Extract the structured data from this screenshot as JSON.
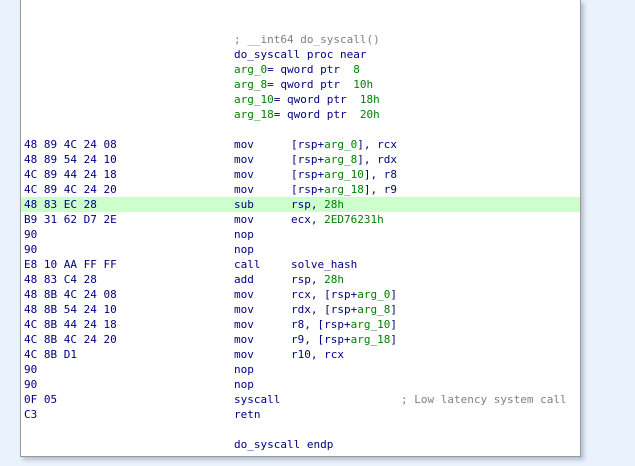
{
  "header_comment": "; __int64 do_syscall()",
  "proc_start": "do_syscall proc near",
  "args": [
    {
      "name": "arg_0",
      "rest": "= qword ptr  ",
      "val": "8"
    },
    {
      "name": "arg_8",
      "rest": "= qword ptr  ",
      "val": "10h"
    },
    {
      "name": "arg_10",
      "rest": "= qword ptr  ",
      "val": "18h"
    },
    {
      "name": "arg_18",
      "rest": "= qword ptr  ",
      "val": "20h"
    }
  ],
  "rows": [
    {
      "bytes": "48 89 4C 24 08",
      "mn": "mov",
      "op": "[rsp+arg_0], rcx"
    },
    {
      "bytes": "48 89 54 24 10",
      "mn": "mov",
      "op": "[rsp+arg_8], rdx"
    },
    {
      "bytes": "4C 89 44 24 18",
      "mn": "mov",
      "op": "[rsp+arg_10], r8"
    },
    {
      "bytes": "4C 89 4C 24 20",
      "mn": "mov",
      "op": "[rsp+arg_18], r9"
    },
    {
      "bytes": "48 83 EC 28",
      "mn": "sub",
      "op": "rsp, 28h",
      "highlight": true
    },
    {
      "bytes": "B9 31 62 D7 2E",
      "mn": "mov",
      "op": "ecx, 2ED76231h"
    },
    {
      "bytes": "90",
      "mn": "nop",
      "op": ""
    },
    {
      "bytes": "90",
      "mn": "nop",
      "op": ""
    },
    {
      "bytes": "E8 10 AA FF FF",
      "mn": "call",
      "op": "solve_hash"
    },
    {
      "bytes": "48 83 C4 28",
      "mn": "add",
      "op": "rsp, 28h"
    },
    {
      "bytes": "48 8B 4C 24 08",
      "mn": "mov",
      "op": "rcx, [rsp+arg_0]"
    },
    {
      "bytes": "48 8B 54 24 10",
      "mn": "mov",
      "op": "rdx, [rsp+arg_8]"
    },
    {
      "bytes": "4C 8B 44 24 18",
      "mn": "mov",
      "op": "r8, [rsp+arg_10]"
    },
    {
      "bytes": "4C 8B 4C 24 20",
      "mn": "mov",
      "op": "r9, [rsp+arg_18]"
    },
    {
      "bytes": "4C 8B D1",
      "mn": "mov",
      "op": "r10, rcx"
    },
    {
      "bytes": "90",
      "mn": "nop",
      "op": ""
    },
    {
      "bytes": "90",
      "mn": "nop",
      "op": ""
    },
    {
      "bytes": "0F 05",
      "mn": "syscall",
      "op": "",
      "comment": "; Low latency system call"
    },
    {
      "bytes": "C3",
      "mn": "retn",
      "op": ""
    }
  ],
  "proc_end": "do_syscall endp",
  "colors": {
    "highlight": "#ccffcc",
    "code": "#000080",
    "comment": "#808080",
    "variable": "#008000"
  }
}
